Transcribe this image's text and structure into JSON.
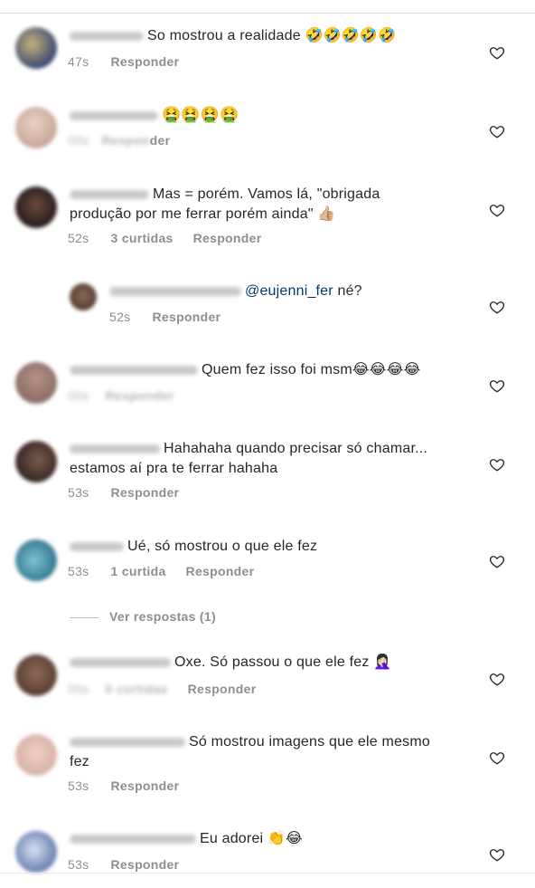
{
  "comments": [
    {
      "text": "So mostrou a realidade 🤣🤣🤣🤣🤣",
      "time": "47s",
      "likes": "",
      "reply": "Responder",
      "avatar_color": "#3b4a72"
    },
    {
      "text": "🤮🤮🤮🤮",
      "time": "",
      "likes": "",
      "reply": "der",
      "avatar_color": "#c9a99b"
    },
    {
      "text_line1": "Mas = porém. Vamos lá, \"obrigada",
      "text_line2": "produção por me ferrar porém ainda\" 👍🏼",
      "time": "52s",
      "likes": "3 curtidas",
      "reply": "Responder",
      "avatar_color": "#2b1f1d"
    },
    {
      "mention": "@eujenni_fer",
      "text": " né?",
      "time": "52s",
      "likes": "",
      "reply": "Responder",
      "avatar_color": "#5a4033"
    },
    {
      "text": "Quem fez isso foi msm😂😂😂😂",
      "time": "",
      "likes": "",
      "reply": "",
      "avatar_color": "#8c7068"
    },
    {
      "text_line1": "Hahahaha quando precisar só chamar...",
      "text_line2": "estamos aí pra te ferrar hahaha",
      "time": "53s",
      "likes": "",
      "reply": "Responder",
      "avatar_color": "#3a2a26"
    },
    {
      "text": "Ué, só mostrou o que ele fez",
      "time": "53s",
      "likes": "1 curtida",
      "reply": "Responder",
      "avatar_color": "#3a7f95"
    },
    {
      "text": "Oxe. Só passou o que ele fez 🤦🏻‍♀️",
      "time": "",
      "likes": "",
      "reply": "Responder",
      "avatar_color": "#5c4236"
    },
    {
      "text_line1": "Só mostrou imagens que ele mesmo",
      "text_line2": "fez",
      "time": "53s",
      "likes": "",
      "reply": "Responder",
      "avatar_color": "#d8b4a8"
    },
    {
      "text": "Eu adorei 👏😂",
      "time": "53s",
      "likes": "",
      "reply": "Responder",
      "avatar_color": "#6f86b3"
    }
  ],
  "view_replies": "Ver respostas (1)",
  "icons": {
    "heart": "heart-outline-icon"
  }
}
